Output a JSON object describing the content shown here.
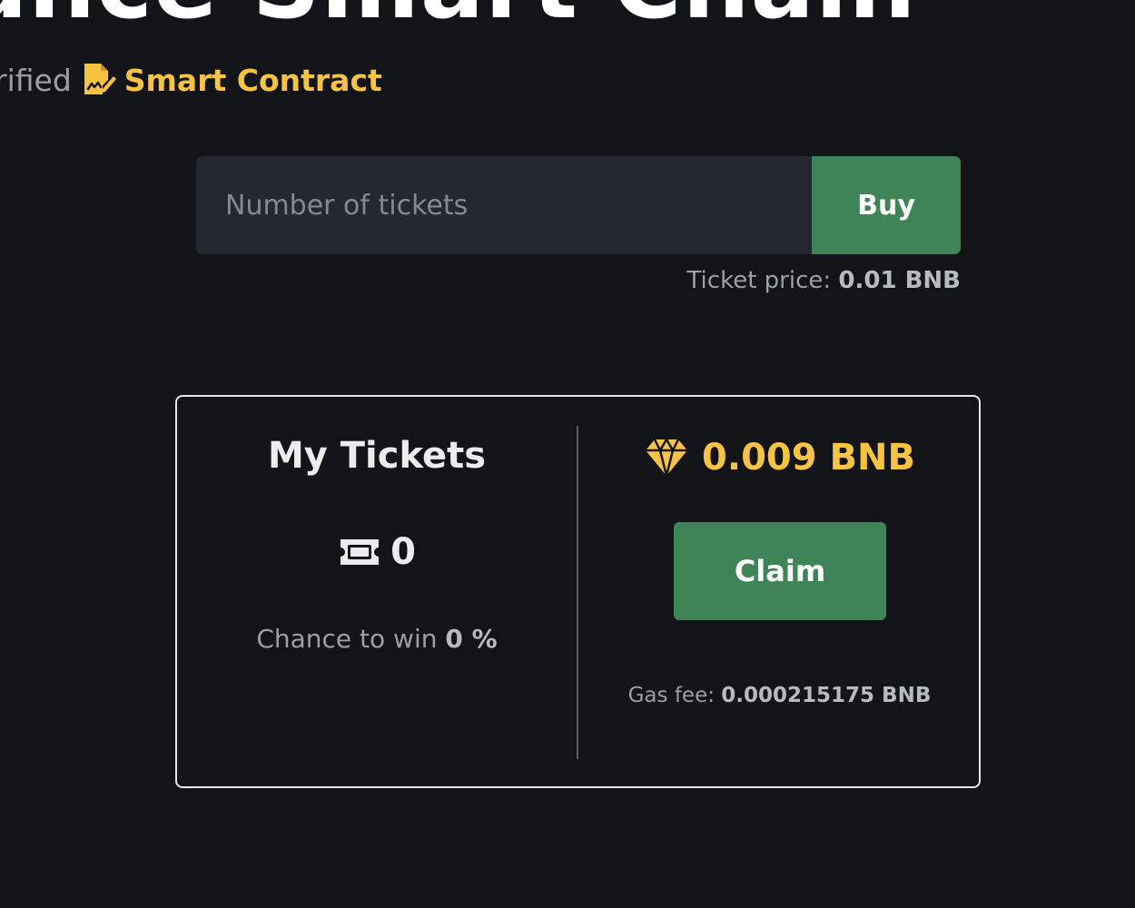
{
  "header": {
    "title": "ance Smart Chain",
    "verified_text": "rified",
    "contract_link": "Smart Contract"
  },
  "buy_section": {
    "input_placeholder": "Number of tickets",
    "buy_label": "Buy",
    "price_label": "Ticket price:",
    "price_value": "0.01 BNB"
  },
  "tickets_card": {
    "title": "My Tickets",
    "ticket_count": "0",
    "chance_label": "Chance to win",
    "chance_value": "0 %"
  },
  "prize_card": {
    "amount": "0.009 BNB",
    "claim_label": "Claim",
    "gas_label": "Gas fee:",
    "gas_value": "0.000215175 BNB"
  },
  "colors": {
    "background": "#131418",
    "accent_yellow": "#f7c342",
    "button_green": "#3e8456",
    "input_bg": "#242830"
  },
  "icons": {
    "contract": "file-signature-icon",
    "ticket": "ticket-icon",
    "prize": "diamond-icon"
  }
}
